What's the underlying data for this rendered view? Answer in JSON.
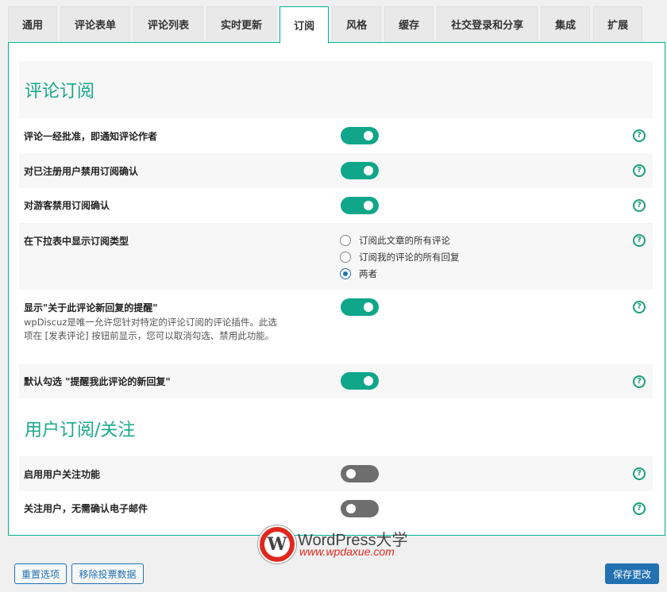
{
  "tabs": [
    {
      "label": "通用"
    },
    {
      "label": "评论表单"
    },
    {
      "label": "评论列表"
    },
    {
      "label": "实时更新"
    },
    {
      "label": "订阅",
      "active": true
    },
    {
      "label": "风格"
    },
    {
      "label": "缓存"
    },
    {
      "label": "社交登录和分享"
    },
    {
      "label": "集成"
    },
    {
      "label": "扩展"
    }
  ],
  "sections": {
    "comment_subscription": "评论订阅",
    "user_subscription": "用户订阅/关注"
  },
  "settings": {
    "notify_author_on_approve": {
      "label": "评论一经批准，即通知评论作者",
      "enabled": true
    },
    "disable_confirm_registered": {
      "label": "对已注册用户禁用订阅确认",
      "enabled": true
    },
    "disable_confirm_guests": {
      "label": "对游客禁用订阅确认",
      "enabled": true
    },
    "dropdown_types": {
      "label": "在下拉表中显示订阅类型",
      "options": [
        "订阅此文章的所有评论",
        "订阅我的评论的所有回复",
        "两者"
      ],
      "selected": 2
    },
    "show_reply_reminder": {
      "label": "显示\"关于此评论新回复的提醒\"",
      "description": "wpDiscuz是唯一允许您针对特定的评论订阅的评论插件。此选项在 [发表评论] 按钮前显示，您可以取消勾选、禁用此功能。",
      "enabled": true
    },
    "default_checked_reminder": {
      "label": "默认勾选 \"提醒我此评论的新回复\"",
      "enabled": true
    },
    "enable_follow": {
      "label": "启用用户关注功能",
      "enabled": false
    },
    "follow_no_confirm": {
      "label": "关注用户，无需确认电子邮件",
      "enabled": false
    }
  },
  "help_icon": "?",
  "buttons": {
    "reset": "重置选项",
    "remove_votes": "移除投票数据",
    "save": "保存更改"
  },
  "watermark": {
    "logo_letter": "W",
    "title": "WordPress大学",
    "url": "www.wpdaxue.com"
  },
  "colors": {
    "accent": "#00b38f",
    "toggle_on": "#0fa68a",
    "toggle_off": "#6e6e6e",
    "section_title": "#1aa88c",
    "primary_button": "#2271b1"
  }
}
